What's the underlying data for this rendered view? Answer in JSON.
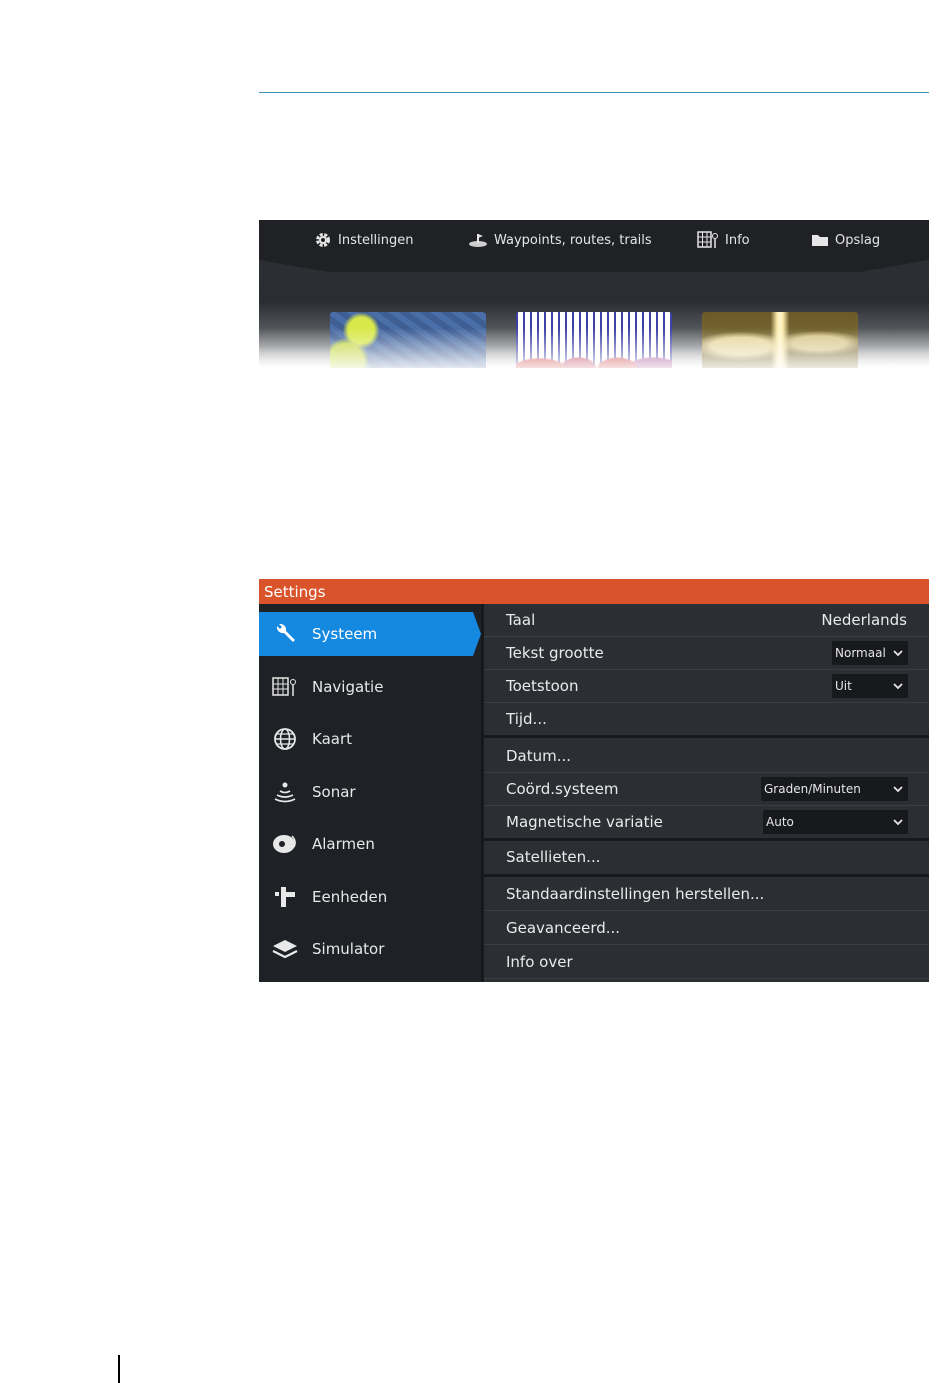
{
  "home_screen": {
    "tabs": [
      {
        "label": "Instellingen",
        "icon": "gear-icon"
      },
      {
        "label": "Waypoints, routes, trails",
        "icon": "waypoint-icon"
      },
      {
        "label": "Info",
        "icon": "info-grid-icon"
      },
      {
        "label": "Opslag",
        "icon": "folder-icon"
      }
    ],
    "tiles": [
      "chart-thumbnail",
      "sonar-thumbnail",
      "structurescan-thumbnail"
    ]
  },
  "settings": {
    "title": "Settings",
    "accent_color": "#d9542b",
    "active_color": "#1588e0",
    "sidebar": [
      {
        "label": "Systeem",
        "icon": "wrench-icon",
        "active": true
      },
      {
        "label": "Navigatie",
        "icon": "navigation-icon",
        "active": false
      },
      {
        "label": "Kaart",
        "icon": "globe-icon",
        "active": false
      },
      {
        "label": "Sonar",
        "icon": "sonar-icon",
        "active": false
      },
      {
        "label": "Alarmen",
        "icon": "alarm-icon",
        "active": false
      },
      {
        "label": "Eenheden",
        "icon": "units-icon",
        "active": false
      },
      {
        "label": "Simulator",
        "icon": "layers-icon",
        "active": false
      }
    ],
    "rows": {
      "taal": {
        "label": "Taal",
        "value": "Nederlands"
      },
      "tekst": {
        "label": "Tekst grootte",
        "value": "Normaal"
      },
      "toets": {
        "label": "Toetstoon",
        "value": "Uit"
      },
      "tijd": {
        "label": "Tijd..."
      },
      "datum": {
        "label": "Datum..."
      },
      "coord": {
        "label": "Coörd.systeem",
        "value": "Graden/Minuten"
      },
      "magn": {
        "label": "Magnetische variatie",
        "value": "Auto"
      },
      "sat": {
        "label": "Satellieten..."
      },
      "std": {
        "label": "Standaardinstellingen herstellen..."
      },
      "geav": {
        "label": "Geavanceerd..."
      },
      "info": {
        "label": "Info over"
      }
    }
  }
}
